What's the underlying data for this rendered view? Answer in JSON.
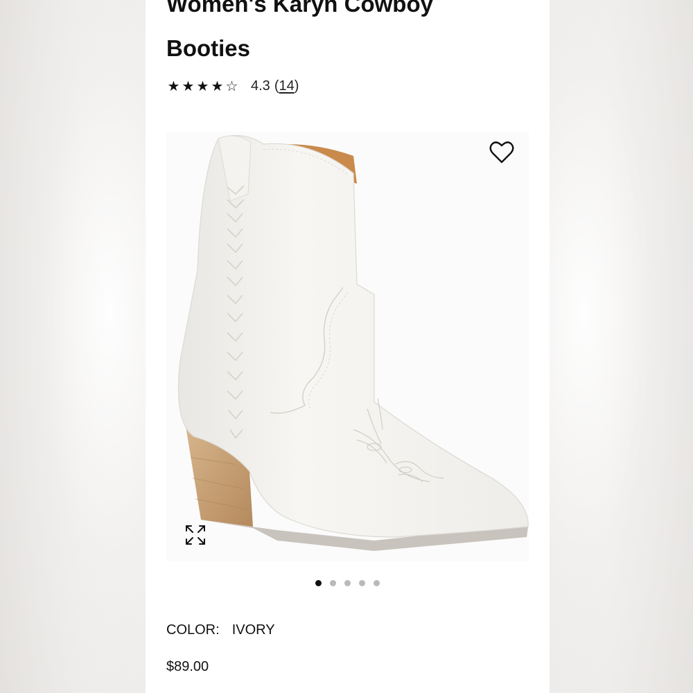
{
  "product": {
    "title_line1": "Women's Karyn Cowboy",
    "title_line2": "Booties",
    "rating": {
      "stars": [
        "★",
        "★",
        "★",
        "★",
        "☆"
      ],
      "value": "4.3",
      "count": "14",
      "paren_open": "(",
      "paren_close": ")"
    },
    "color_label": "COLOR:",
    "color_value": "IVORY",
    "price": "$89.00"
  },
  "gallery": {
    "image_count": 5,
    "active_index": 0,
    "favorite_icon": "heart-outline-icon",
    "expand_icon": "expand-arrows-icon"
  },
  "colors": {
    "text": "#111111",
    "dot_active": "#111111",
    "dot_inactive": "#b9b9b9",
    "boot_body": "#f3f2ef",
    "heel_wood": "#c9a47c",
    "sole": "#c8c3bc",
    "lining": "#c98a4b"
  }
}
